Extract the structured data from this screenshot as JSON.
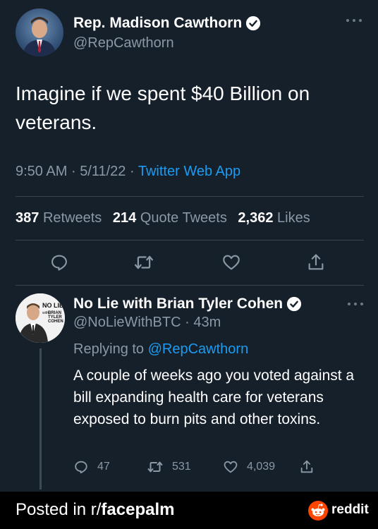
{
  "main_tweet": {
    "display_name": "Rep. Madison Cawthorn",
    "handle": "@RepCawthorn",
    "text": "Imagine if we spent $40 Billion on veterans.",
    "time": "9:50 AM",
    "date": "5/11/22",
    "app": "Twitter Web App",
    "retweets_count": "387",
    "retweets_label": "Retweets",
    "quote_count": "214",
    "quote_label": "Quote Tweets",
    "likes_count": "2,362",
    "likes_label": "Likes",
    "icons": [
      "reply-icon",
      "retweet-icon",
      "like-icon",
      "share-icon"
    ]
  },
  "reply": {
    "display_name": "No Lie with Brian Tyler Cohen",
    "handle": "@NoLieWithBTC",
    "time": "43m",
    "replying_prefix": "Replying to",
    "replying_to": "@RepCawthorn",
    "text": "A couple of weeks ago you voted against a bill expanding health care for veterans exposed to burn pits and other toxins.",
    "reply_count": "47",
    "retweet_count": "531",
    "like_count": "4,039",
    "avatar_logo_text": [
      "NO LIE",
      "with",
      "BRIAN",
      "TYLER",
      "COHEN"
    ]
  },
  "footer": {
    "prefix": "Posted in r/",
    "subreddit": "facepalm",
    "brand": "reddit"
  },
  "colors": {
    "background": "#15202b",
    "accent": "#1d9bf0",
    "secondary_text": "#8b98a5",
    "divider": "#38444d",
    "footer_bg": "#000000",
    "reddit_orange": "#ff4500"
  }
}
